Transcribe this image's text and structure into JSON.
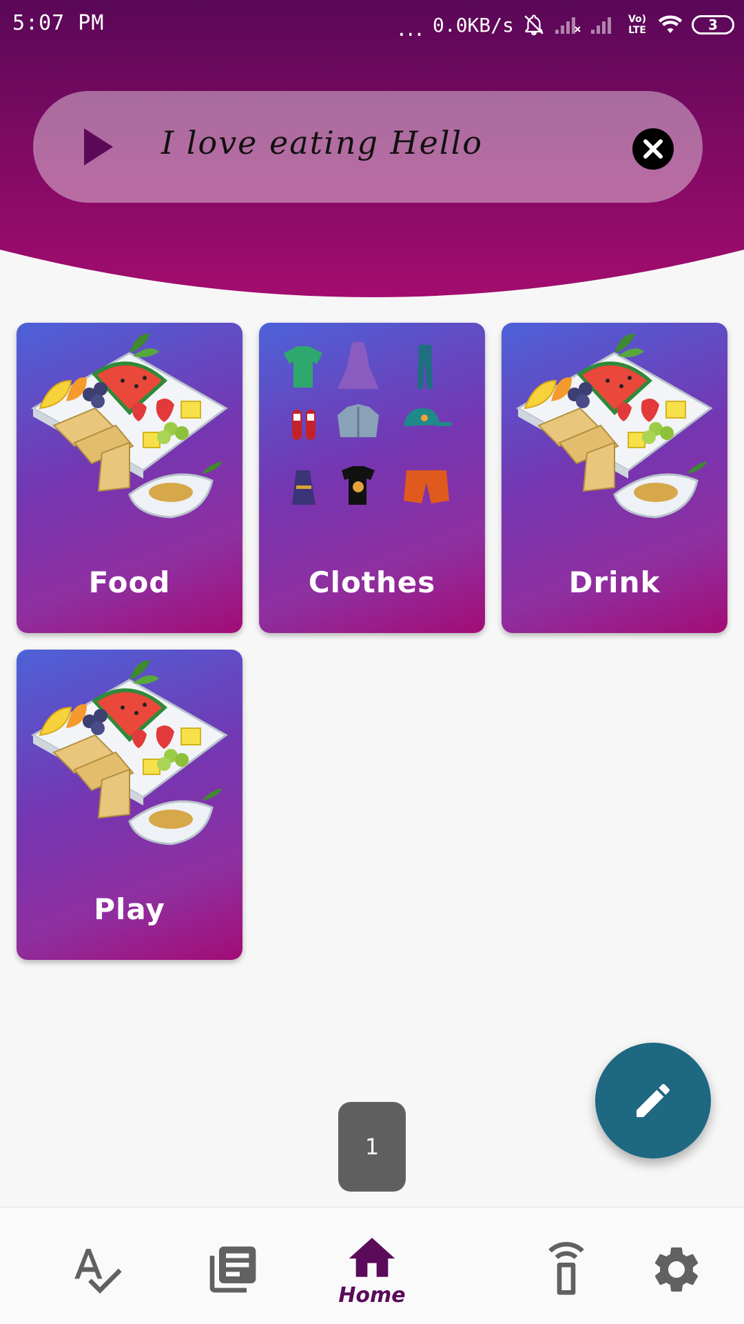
{
  "status_bar": {
    "time": "5:07 PM",
    "more": "...",
    "net_speed": "0.0KB/s",
    "network_tag": "Vo) LTE",
    "battery": "3"
  },
  "speech_bar": {
    "text": "I love eating Hello"
  },
  "categories": [
    {
      "label": "Food"
    },
    {
      "label": "Clothes"
    },
    {
      "label": "Drink"
    },
    {
      "label": "Play"
    }
  ],
  "page_indicator": "1",
  "bottom_nav": {
    "items": [
      {
        "icon": "spellcheck-icon"
      },
      {
        "icon": "library-books-icon"
      },
      {
        "icon": "home-icon",
        "label": "Home",
        "active": true
      },
      {
        "icon": "remote-device-icon"
      },
      {
        "icon": "settings-gear-icon"
      }
    ]
  },
  "colors": {
    "header_top": "#5a0858",
    "header_bottom": "#a30c6e",
    "card_gradient_start": "#4d62d8",
    "card_gradient_end": "#a30c75",
    "fab": "#1e6882",
    "nav_active": "#5a0b5a",
    "nav_inactive": "#616161"
  }
}
